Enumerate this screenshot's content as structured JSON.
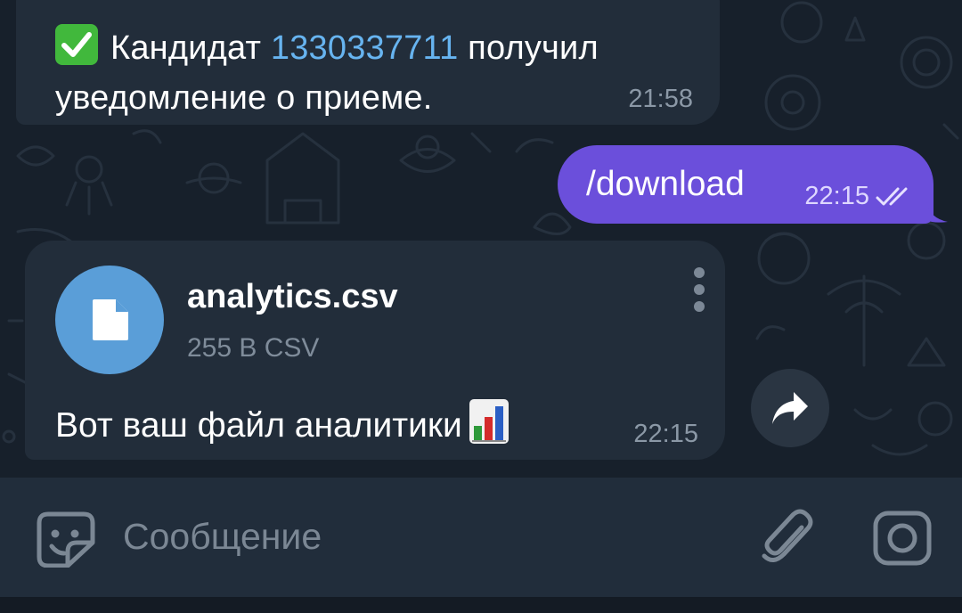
{
  "colors": {
    "background": "#17202b",
    "incoming_bubble": "#222d3a",
    "outgoing_bubble": "#6b4fdb",
    "link": "#67b4f0",
    "file_icon": "#5a9ed8",
    "input_bar": "#212d3b"
  },
  "messages": [
    {
      "direction": "incoming",
      "emoji": "check-mark-button",
      "text_before": "Кандидат ",
      "link": "1330337711",
      "text_after": " получил уведомление о приеме.",
      "time": "21:58"
    },
    {
      "direction": "outgoing",
      "text": "/download",
      "time": "22:15",
      "status": "read-double-check"
    },
    {
      "direction": "incoming",
      "file": {
        "name": "analytics.csv",
        "meta": "255 B CSV",
        "icon": "document-icon"
      },
      "caption": "Вот ваш файл аналитики",
      "caption_emoji": "bar-chart",
      "time": "22:15"
    }
  ],
  "input": {
    "placeholder": "Сообщение",
    "value": ""
  },
  "icons": {
    "left": "sticker-icon",
    "right": [
      "attach-icon",
      "camera-icon"
    ],
    "share": "share-icon",
    "more": "more-vertical-icon"
  }
}
